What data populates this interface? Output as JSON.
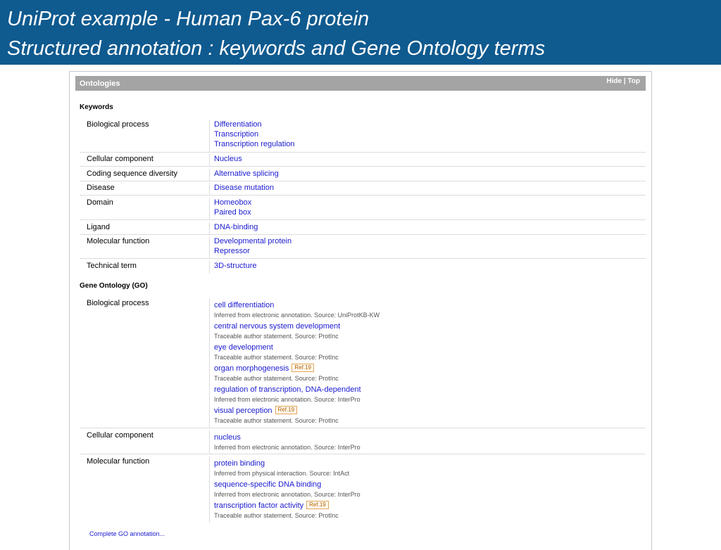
{
  "slide": {
    "title_line1": "UniProt example - Human Pax-6 protein",
    "title_line2": "Structured annotation : keywords and Gene Ontology terms"
  },
  "section": {
    "title": "Ontologies",
    "hide": "Hide",
    "sep": " | ",
    "top": "Top"
  },
  "keywords": {
    "heading": "Keywords",
    "rows": [
      {
        "label": "Biological process",
        "values": [
          "Differentiation",
          "Transcription",
          "Transcription regulation"
        ]
      },
      {
        "label": "Cellular component",
        "values": [
          "Nucleus"
        ]
      },
      {
        "label": "Coding sequence diversity",
        "values": [
          "Alternative splicing"
        ]
      },
      {
        "label": "Disease",
        "values": [
          "Disease mutation"
        ]
      },
      {
        "label": "Domain",
        "values": [
          "Homeobox",
          "Paired box"
        ]
      },
      {
        "label": "Ligand",
        "values": [
          "DNA-binding"
        ]
      },
      {
        "label": "Molecular function",
        "values": [
          "Developmental protein",
          "Repressor"
        ]
      },
      {
        "label": "Technical term",
        "values": [
          "3D-structure"
        ]
      }
    ]
  },
  "go": {
    "heading": "Gene Ontology (GO)",
    "rows": [
      {
        "label": "Biological process",
        "items": [
          {
            "term": "cell differentiation",
            "ref": "",
            "evidence": "Inferred from electronic annotation. Source: UniProtKB-KW"
          },
          {
            "term": "central nervous system development",
            "ref": "",
            "evidence": "Traceable author statement. Source: ProtInc"
          },
          {
            "term": "eye development",
            "ref": "",
            "evidence": "Traceable author statement. Source: ProtInc"
          },
          {
            "term": "organ morphogenesis",
            "ref": "Ref.19",
            "evidence": "Traceable author statement. Source: ProtInc"
          },
          {
            "term": "regulation of transcription, DNA-dependent",
            "ref": "",
            "evidence": "Inferred from electronic annotation. Source: InterPro"
          },
          {
            "term": "visual perception",
            "ref": "Ref.19",
            "evidence": "Traceable author statement. Source: ProtInc"
          }
        ]
      },
      {
        "label": "Cellular component",
        "items": [
          {
            "term": "nucleus",
            "ref": "",
            "evidence": "Inferred from electronic annotation. Source: InterPro"
          }
        ]
      },
      {
        "label": "Molecular function",
        "items": [
          {
            "term": "protein binding",
            "ref": "",
            "evidence": "Inferred from physical interaction. Source: IntAct"
          },
          {
            "term": "sequence-specific DNA binding",
            "ref": "",
            "evidence": "Inferred from electronic annotation. Source: InterPro"
          },
          {
            "term": "transcription factor activity",
            "ref": "Ref.19",
            "evidence": "Traceable author statement. Source: ProtInc"
          }
        ]
      }
    ]
  },
  "footer": {
    "complete_link": "Complete GO annotation..."
  }
}
